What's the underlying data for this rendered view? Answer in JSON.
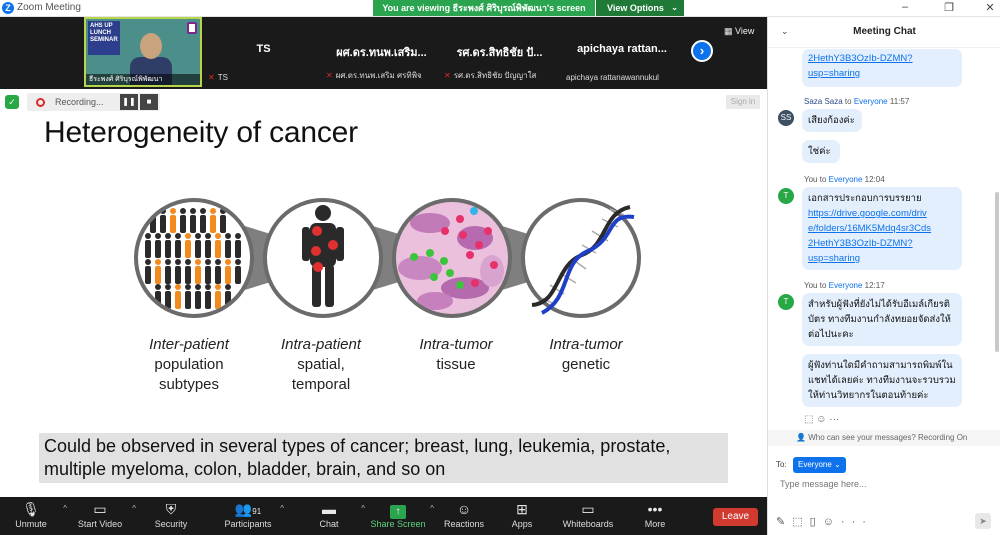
{
  "window": {
    "title": "Zoom Meeting",
    "viewing_banner": "You are viewing ธีระพงศ์ ศิริบุรณ์พิพัฒนา's screen",
    "view_options": "View Options",
    "controls": [
      "–",
      "❐",
      "✕"
    ]
  },
  "gallery": {
    "self": {
      "name": "ธีระพงศ์ ศิริบุรณ์พิพัฒนา",
      "banner": "AHS UP LUNCH SEMINAR"
    },
    "tiles": [
      {
        "big": "TS",
        "small": "TS"
      },
      {
        "big": "ผศ.ดร.ทนพ.เสริม...",
        "small": "ผศ.ดร.ทนพ.เสริม ศรทิพิจ"
      },
      {
        "big": "รศ.ดร.สิทธิชัย ปั...",
        "small": "รศ.ดร.สิทธิชัย ปัญญาใส"
      },
      {
        "big": "apichaya  rattan...",
        "small": "apichaya rattanawannukul"
      }
    ],
    "view_label": "View"
  },
  "recording": {
    "label": "Recording...",
    "pause": "❚❚",
    "stop": "■"
  },
  "sign_in": "Sign in",
  "slide": {
    "title": "Heterogeneity of cancer",
    "captions": [
      {
        "italic": "Inter-patient",
        "lines": [
          "population",
          "subtypes"
        ]
      },
      {
        "italic": "Intra-patient",
        "lines": [
          "spatial,",
          "temporal"
        ]
      },
      {
        "italic": "Intra-tumor",
        "lines": [
          "tissue"
        ]
      },
      {
        "italic": "Intra-tumor",
        "lines": [
          "genetic"
        ]
      }
    ],
    "footer_line1": "Could be observed in several types of cancer; breast, lung, leukemia, prostate,",
    "footer_line2": "multiple myeloma, colon, bladder, brain, and so on"
  },
  "toolbar": {
    "items": [
      {
        "id": "unmute",
        "label": "Unmute",
        "icon": "mic-off-icon"
      },
      {
        "id": "start-video",
        "label": "Start Video",
        "icon": "video-off-icon"
      },
      {
        "id": "security",
        "label": "Security",
        "icon": "shield-icon"
      },
      {
        "id": "participants",
        "label": "Participants",
        "icon": "people-icon",
        "count": "91"
      },
      {
        "id": "chat",
        "label": "Chat",
        "icon": "chat-icon"
      },
      {
        "id": "share-screen",
        "label": "Share Screen",
        "icon": "share-icon"
      },
      {
        "id": "reactions",
        "label": "Reactions",
        "icon": "emoji-icon"
      },
      {
        "id": "apps",
        "label": "Apps",
        "icon": "apps-icon"
      },
      {
        "id": "whiteboards",
        "label": "Whiteboards",
        "icon": "whiteboard-icon"
      },
      {
        "id": "more",
        "label": "More",
        "icon": "more-icon"
      }
    ],
    "leave": "Leave",
    "share_color": "#2aa44f",
    "leave_color": "#d03a2f"
  },
  "chat": {
    "title": "Meeting Chat",
    "top_link": [
      "2HethY3B3OzIb-DZMN?",
      "usp=sharing"
    ],
    "msg1": {
      "sender": "Saza Saza",
      "to": "Everyone",
      "time": "11:57",
      "avatar": "SS",
      "lines": [
        "เสียงก้องค่ะ",
        "ใช่ค่ะ"
      ]
    },
    "msg2": {
      "sender": "You",
      "to": "Everyone",
      "time": "12:04",
      "avatar": "T",
      "text": "เอกสารประกอบการบรรยาย",
      "link": [
        "https://drive.google.com/driv",
        "e/folders/16MK5Mdq4sr3Cds",
        "2HethY3B3OzIb-DZMN?",
        "usp=sharing"
      ]
    },
    "msg3": {
      "sender": "You",
      "to": "Everyone",
      "time": "12:17",
      "avatar": "T",
      "lines": [
        "สำหรับผู้ฟังที่ยังไม่ได้รับอีเมล์เกียรติ",
        "บัตร ทางทีมงานกำลังทยอยจัดส่งให้",
        "ต่อไปนะคะ"
      ],
      "lines2": [
        "ผู้ฟังท่านใดมีคำถามสามารถพิมพ์ใน",
        "แชทได้เลยค่ะ ทางทีมงานจะรวบรวม",
        "ให้ท่านวิทยากรในตอนท้ายค่ะ"
      ]
    },
    "who_can_see": "Who can see your messages? Recording On",
    "to_label": "To:",
    "recipient": "Everyone",
    "placeholder": "Type message here...",
    "accent": "#0e72ed"
  }
}
